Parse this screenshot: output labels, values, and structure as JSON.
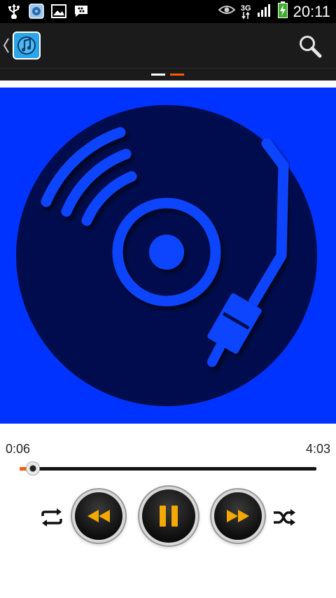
{
  "status_bar": {
    "time": "20:11",
    "network": "3G",
    "icons_left": [
      "usb-icon",
      "app-notification-icon",
      "gallery-icon",
      "bbm-icon"
    ],
    "icons_right": [
      "eye-icon",
      "network-3g-icon",
      "signal-icon",
      "battery-charging-icon"
    ]
  },
  "action_bar": {
    "back_icon": "chevron-left-icon",
    "app_icon": "music-app-icon",
    "search_icon": "search-icon"
  },
  "pager": {
    "pages": 2,
    "active_index": 1
  },
  "artwork": {
    "description_icon": "vinyl-turntable-icon",
    "background_color": "#0033ff",
    "disc_color": "#001a4d"
  },
  "player": {
    "elapsed": "0:06",
    "total": "4:03",
    "progress_fraction": 0.025
  },
  "controls": {
    "repeat_icon": "repeat-icon",
    "rewind_icon": "rewind-icon",
    "pause_icon": "pause-icon",
    "fast_forward_icon": "fast-forward-icon",
    "shuffle_icon": "shuffle-icon",
    "accent_color": "#f5a800"
  },
  "colors": {
    "progress_accent": "#ff5a00"
  }
}
